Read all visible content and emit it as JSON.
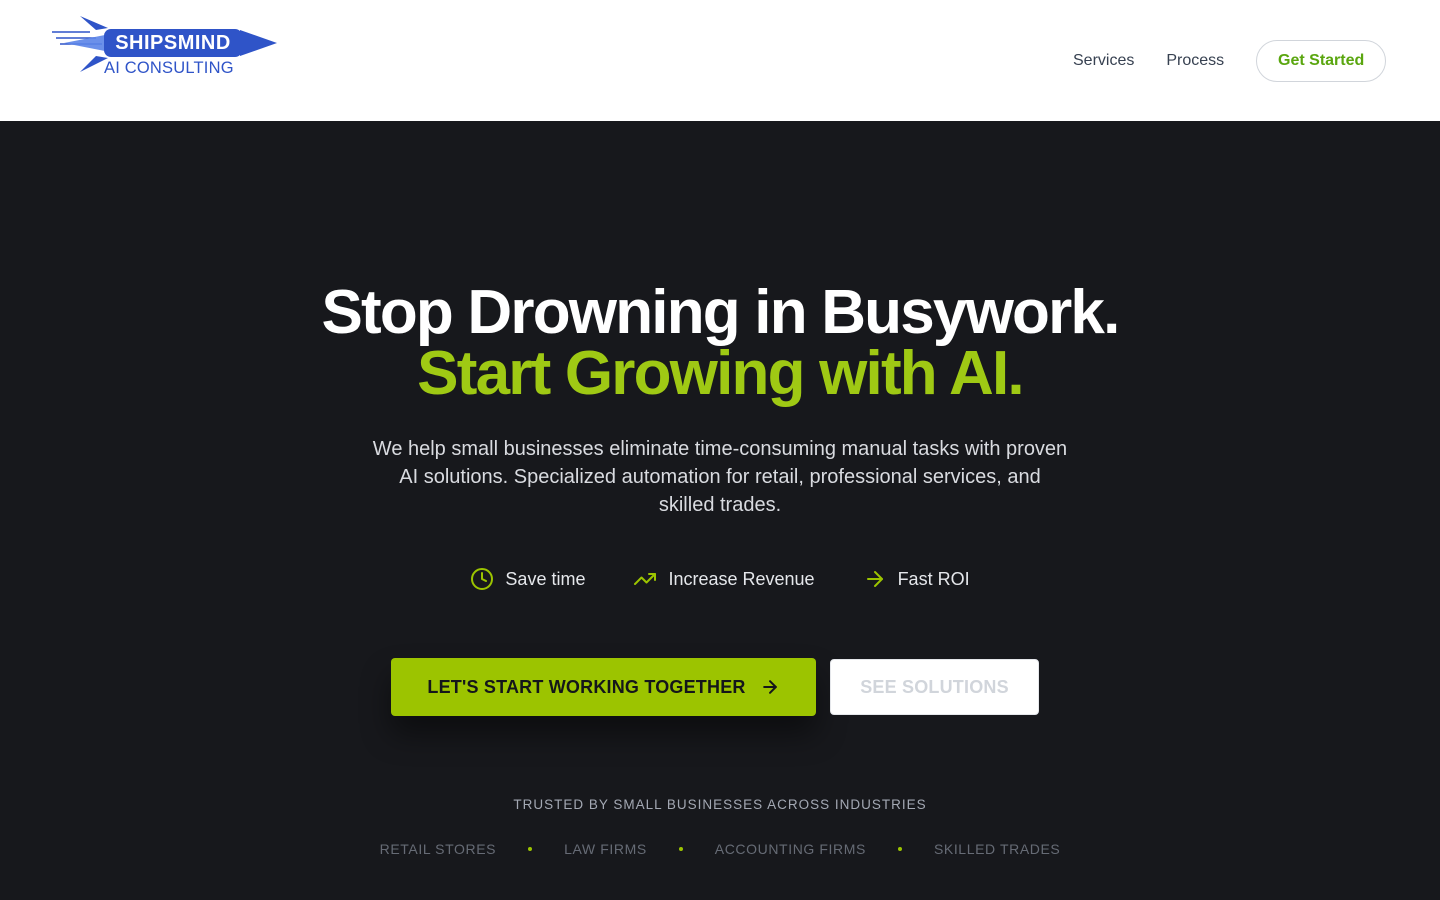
{
  "brand": {
    "name": "SHIPSMIND",
    "tagline": "AI CONSULTING",
    "logo_icon": "rocket-arrow-logo"
  },
  "nav": {
    "items": [
      {
        "label": "Services"
      },
      {
        "label": "Process"
      }
    ],
    "cta_label": "Get Started"
  },
  "hero": {
    "headline_line1": "Stop Drowning in Busywork.",
    "headline_line2": "Start Growing with AI.",
    "subheadline": "We help small businesses eliminate time-consuming manual tasks with proven AI solutions. Specialized automation for retail, professional services, and skilled trades.",
    "benefits": [
      {
        "icon": "clock-icon",
        "label": "Save time"
      },
      {
        "icon": "trending-up-icon",
        "label": "Increase Revenue"
      },
      {
        "icon": "arrow-right-icon",
        "label": "Fast ROI"
      }
    ],
    "primary_cta": "LET'S START WORKING TOGETHER",
    "secondary_cta": "SEE SOLUTIONS",
    "trusted_by": "TRUSTED BY SMALL BUSINESSES ACROSS INDUSTRIES",
    "industries": [
      "RETAIL STORES",
      "LAW FIRMS",
      "ACCOUNTING FIRMS",
      "SKILLED TRADES"
    ]
  },
  "colors": {
    "accent": "#9cc400",
    "headline_accent": "#9fc914",
    "hero_background": "#17181c",
    "logo_blue": "#2f54c8",
    "get_started_text": "#5aa60f"
  }
}
